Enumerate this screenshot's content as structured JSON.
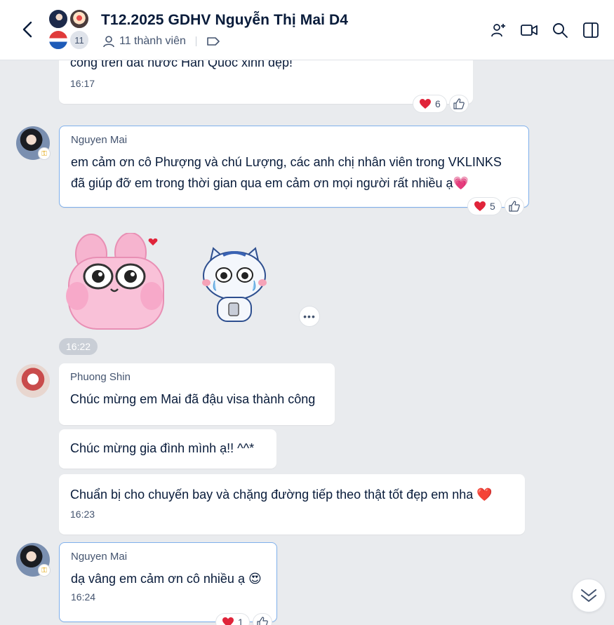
{
  "header": {
    "title": "T12.2025 GDHV Nguyễn Thị Mai D4",
    "member_count_badge": "11",
    "members_label": "11 thành viên"
  },
  "messages": {
    "m1": {
      "partial_text": "công trên đất nước Hàn Quốc xinh đẹp!",
      "time": "16:17",
      "reaction_count": "6"
    },
    "m2": {
      "sender": "Nguyen Mai",
      "text_line1": "em cảm ơn cô Phượng và chú Lượng, các anh chị nhân viên trong VKLINKS",
      "text_line2": "đã giúp đỡ em trong thời gian qua em cảm ơn mọi người rất nhiều ạ",
      "emoji": "💗",
      "reaction_count": "5"
    },
    "stickers": {
      "time": "16:22",
      "more": "•••"
    },
    "m3": {
      "sender": "Phuong Shin",
      "text": "Chúc mừng em Mai đã đậu visa thành công"
    },
    "m4": {
      "text": "Chúc mừng gia đình mình ạ!! ^^*"
    },
    "m5": {
      "text": "Chuẩn bị cho chuyến bay và chặng đường tiếp theo thật tốt đẹp em nha",
      "emoji": "❤️",
      "time": "16:23"
    },
    "m6": {
      "sender": "Nguyen Mai",
      "text": "dạ vâng em cảm ơn cô nhiều ạ",
      "emoji": "😍",
      "time": "16:24",
      "reaction_count": "1"
    }
  },
  "icons": {
    "back": "chevron-left-icon",
    "add_member": "add-user-icon",
    "video": "video-call-icon",
    "search": "search-icon",
    "sidebar": "sidebar-toggle-icon",
    "heart": "heart-icon",
    "like": "thumbs-up-icon",
    "scroll": "double-chevron-down-icon"
  },
  "colors": {
    "background": "#e9ebee",
    "bubble": "#ffffff",
    "highlight_border": "#7fb0ec",
    "heart": "#e0243a"
  }
}
